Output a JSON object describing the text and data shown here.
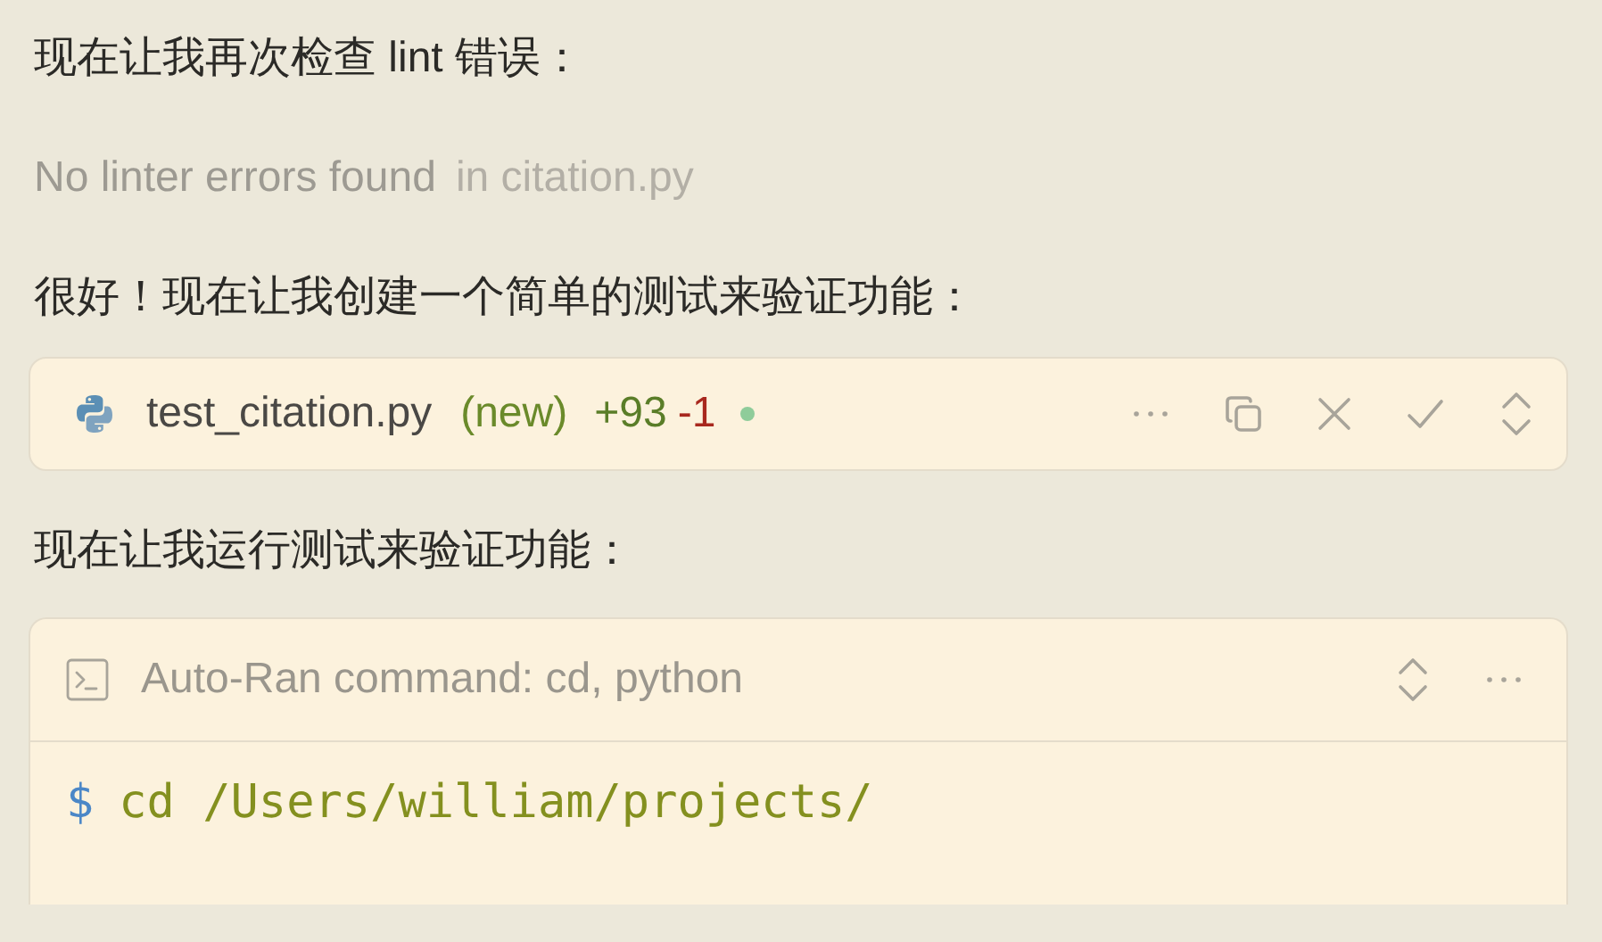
{
  "messages": [
    {
      "kind": "text",
      "text": "现在让我再次检查 lint 错误："
    },
    {
      "kind": "lint",
      "text": "No linter errors found",
      "detail": "in citation.py"
    },
    {
      "kind": "text",
      "text": "很好！现在让我创建一个简单的测试来验证功能："
    },
    {
      "kind": "file",
      "filename": "test_citation.py",
      "tag": "(new)",
      "added": "+93",
      "removed": "-1"
    },
    {
      "kind": "text",
      "text": "现在让我运行测试来验证功能："
    },
    {
      "kind": "terminal",
      "title": "Auto-Ran command: cd, python",
      "prompt": "$",
      "command": "cd /Users/william/projects/"
    }
  ]
}
